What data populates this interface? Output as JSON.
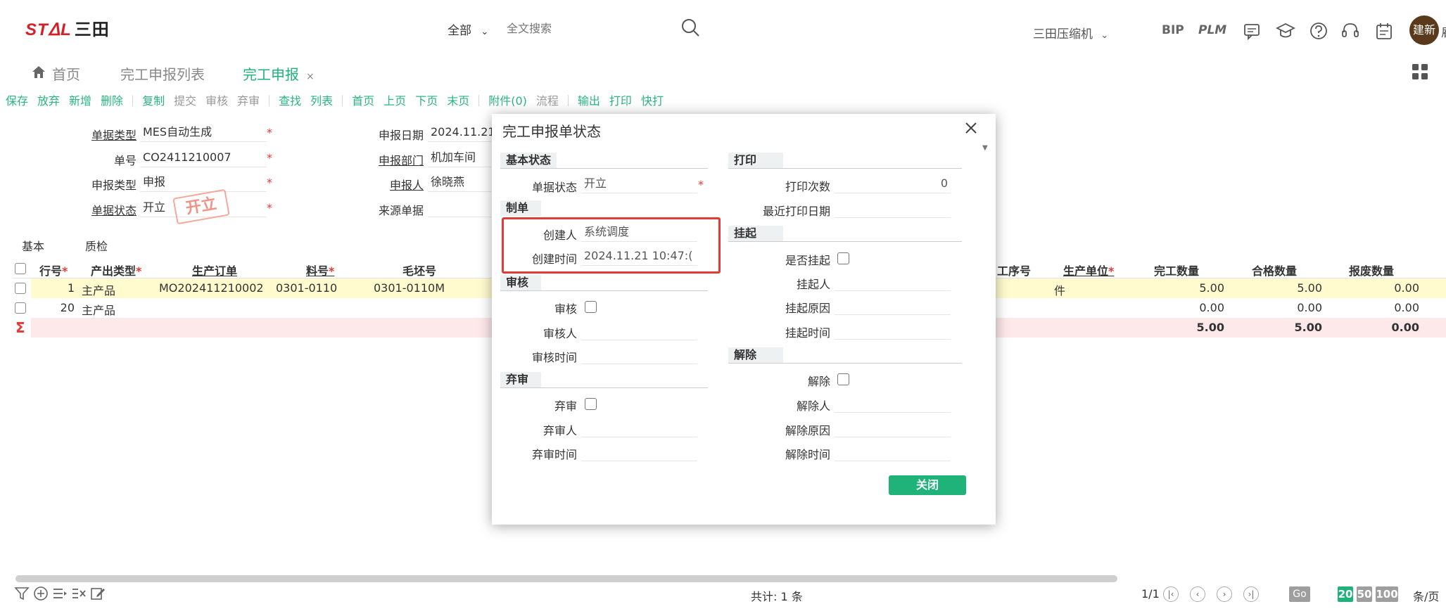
{
  "header": {
    "logo_text": "STᐃL",
    "logo_cn": "三田",
    "search_scope": "全部",
    "search_placeholder": "全文搜索",
    "company": "三田压缩机",
    "nav": [
      "BIP",
      "PLM"
    ],
    "avatar_text": "建新",
    "avatar_tail": "雇"
  },
  "tabs": [
    {
      "label": "首页"
    },
    {
      "label": "完工申报列表"
    },
    {
      "label": "完工申报",
      "close": "×"
    }
  ],
  "toolbar": [
    [
      "保存",
      "放弃",
      "新增",
      "删除"
    ],
    [
      "复制",
      "提交",
      "审核",
      "弃审"
    ],
    [
      "查找",
      "列表"
    ],
    [
      "首页",
      "上页",
      "下页",
      "末页"
    ],
    [
      "附件(0)",
      "流程"
    ],
    [
      "输出",
      "打印",
      "快打"
    ]
  ],
  "form": {
    "doc_type_label": "单据类型",
    "doc_type": "MES自动生成",
    "doc_no_label": "单号",
    "doc_no": "CO2411210007",
    "report_type_label": "申报类型",
    "report_type": "申报",
    "doc_status_label": "单据状态",
    "doc_status": "开立",
    "stamp": "开立",
    "report_date_label": "申报日期",
    "report_date": "2024.11.21",
    "dept_label": "申报部门",
    "dept": "机加车间",
    "reporter_label": "申报人",
    "reporter": "徐晓燕",
    "source_label": "来源单据",
    "source": ""
  },
  "subtabs": [
    "基本",
    "质检"
  ],
  "table": {
    "headers": {
      "line": "行号",
      "output_type": "产出类型",
      "order": "生产订单",
      "material": "料号",
      "blank": "毛坯号",
      "proc_no": "工序号",
      "unit": "生产单位",
      "done_qty": "完工数量",
      "ok_qty": "合格数量",
      "scrap_qty": "报废数量"
    },
    "rows": [
      {
        "line": "1",
        "output_type": "主产品",
        "order": "MO202411210002",
        "material": "0301-0110",
        "blank": "0301-0110M",
        "unit": "件",
        "done_qty": "5.00",
        "ok_qty": "5.00",
        "scrap_qty": "0.00"
      },
      {
        "line": "20",
        "output_type": "主产品",
        "order": "",
        "material": "",
        "blank": "",
        "unit": "",
        "done_qty": "0.00",
        "ok_qty": "0.00",
        "scrap_qty": "0.00"
      }
    ],
    "sum": {
      "symbol": "Σ",
      "done_qty": "5.00",
      "ok_qty": "5.00",
      "scrap_qty": "0.00"
    }
  },
  "footer": {
    "total": "共计: 1 条",
    "page": "1/1",
    "go": "Go",
    "sizes": [
      "20",
      "50",
      "100"
    ],
    "per_page": "条/页"
  },
  "modal": {
    "title": "完工申报单状态",
    "close_label": "关闭",
    "basic": {
      "section": "基本状态",
      "status_label": "单据状态",
      "status": "开立"
    },
    "make": {
      "section": "制单",
      "creator_label": "创建人",
      "creator": "系统调度",
      "time_label": "创建时间",
      "time": "2024.11.21 10:47:("
    },
    "audit": {
      "section": "审核",
      "audit_label": "审核",
      "auditor_label": "审核人",
      "audit_time_label": "审核时间"
    },
    "unaudit": {
      "section": "弃审",
      "label": "弃审",
      "person_label": "弃审人",
      "time_label": "弃审时间"
    },
    "print": {
      "section": "打印",
      "count_label": "打印次数",
      "count": "0",
      "last_label": "最近打印日期"
    },
    "hold": {
      "section": "挂起",
      "flag_label": "是否挂起",
      "person_label": "挂起人",
      "reason_label": "挂起原因",
      "time_label": "挂起时间"
    },
    "release": {
      "section": "解除",
      "flag_label": "解除",
      "person_label": "解除人",
      "reason_label": "解除原因",
      "time_label": "解除时间"
    }
  },
  "colors": {
    "accent": "#1fb37a",
    "highlight": "#e53935",
    "logo": "#d42127"
  }
}
